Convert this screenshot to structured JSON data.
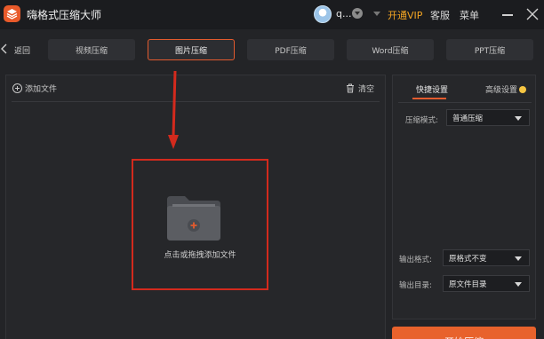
{
  "app": {
    "title": "嗨格式压缩大师"
  },
  "user": {
    "name": "q..."
  },
  "header": {
    "vip_label": "开通VIP",
    "service_label": "客服",
    "menu_label": "菜单"
  },
  "nav": {
    "back_label": "返回",
    "tabs": [
      {
        "label": "视频压缩",
        "active": false
      },
      {
        "label": "图片压缩",
        "active": true
      },
      {
        "label": "PDF压缩",
        "active": false
      },
      {
        "label": "Word压缩",
        "active": false
      },
      {
        "label": "PPT压缩",
        "active": false
      }
    ]
  },
  "file_panel": {
    "add_file_label": "添加文件",
    "clear_label": "清空",
    "drop_text": "点击或拖拽添加文件"
  },
  "settings": {
    "tabs": [
      {
        "label": "快捷设置"
      },
      {
        "label": "高级设置"
      }
    ],
    "compress_mode": {
      "label": "压缩模式:",
      "value": "普通压缩"
    },
    "output_format": {
      "label": "输出格式:",
      "value": "原格式不变"
    },
    "output_dir": {
      "label": "输出目录:",
      "value": "原文件目录"
    }
  },
  "start_button": {
    "label": "开始压缩"
  },
  "colors": {
    "accent": "#e8622c",
    "vip": "#f5a623",
    "annotation_red": "#d32a1d",
    "background": "#232427"
  }
}
